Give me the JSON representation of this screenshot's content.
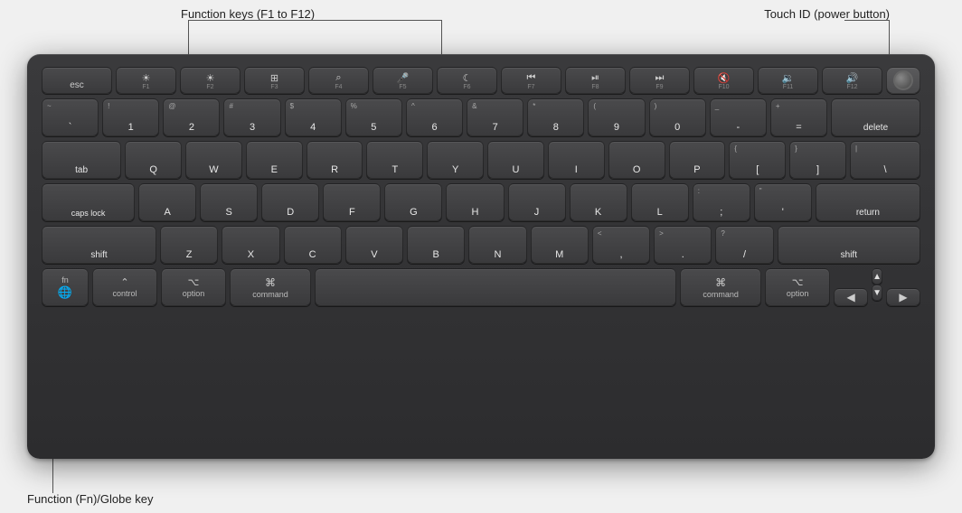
{
  "annotations": {
    "function_keys_label": "Function keys (F1 to F12)",
    "touch_id_label": "Touch ID (power button)",
    "fn_globe_label": "Function (Fn)/Globe key"
  },
  "keyboard": {
    "rows": {
      "fn_row": [
        "esc",
        "F1",
        "F2",
        "F3",
        "F4",
        "F5",
        "F6",
        "F7",
        "F8",
        "F9",
        "F10",
        "F11",
        "F12",
        "TouchID"
      ],
      "num_row": [
        "`~",
        "1!",
        "2@",
        "3#",
        "4$",
        "5%",
        "6^",
        "7&",
        "8*",
        "9(",
        "0)",
        "-_",
        "=+",
        "delete"
      ],
      "row_q": [
        "tab",
        "Q",
        "W",
        "E",
        "R",
        "T",
        "Y",
        "U",
        "I",
        "O",
        "P",
        "[{",
        "]}",
        "\\|"
      ],
      "row_a": [
        "caps lock",
        "A",
        "S",
        "D",
        "F",
        "G",
        "H",
        "J",
        "K",
        "L",
        ";:",
        "'\"",
        "return"
      ],
      "row_z": [
        "shift",
        "Z",
        "X",
        "C",
        "V",
        "B",
        "N",
        "M",
        ",<",
        ".>",
        "/?",
        "shift"
      ],
      "bottom": [
        "fn/globe",
        "control",
        "option",
        "command",
        "space",
        "command",
        "option",
        "◀",
        "▲▼",
        "▶"
      ]
    }
  }
}
